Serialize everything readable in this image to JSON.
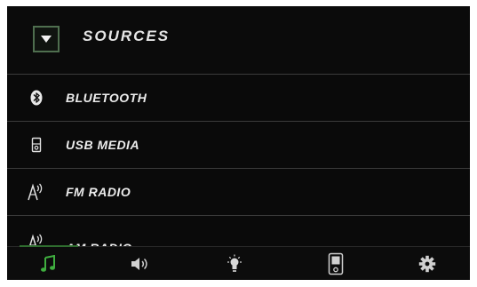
{
  "header": {
    "title": "SOURCES",
    "toggle_icon": "triangle-down-icon"
  },
  "sources": [
    {
      "label": "BLUETOOTH",
      "icon": "bluetooth-icon"
    },
    {
      "label": "USB MEDIA",
      "icon": "usb-media-icon"
    },
    {
      "label": "FM RADIO",
      "icon": "radio-antenna-icon"
    },
    {
      "label": "AM RADIO",
      "icon": "radio-antenna-icon"
    }
  ],
  "bottom_nav": [
    {
      "icon": "music-note-icon",
      "active": true
    },
    {
      "icon": "speaker-volume-icon",
      "active": false
    },
    {
      "icon": "light-bulb-icon",
      "active": false
    },
    {
      "icon": "media-player-device-icon",
      "active": false
    },
    {
      "icon": "gear-icon",
      "active": false
    }
  ],
  "colors": {
    "background": "#0a0a0a",
    "accent_green": "#3fae3f",
    "divider": "#3b3b3b",
    "text": "#ececec",
    "icon_inactive": "#d0d0d0"
  }
}
